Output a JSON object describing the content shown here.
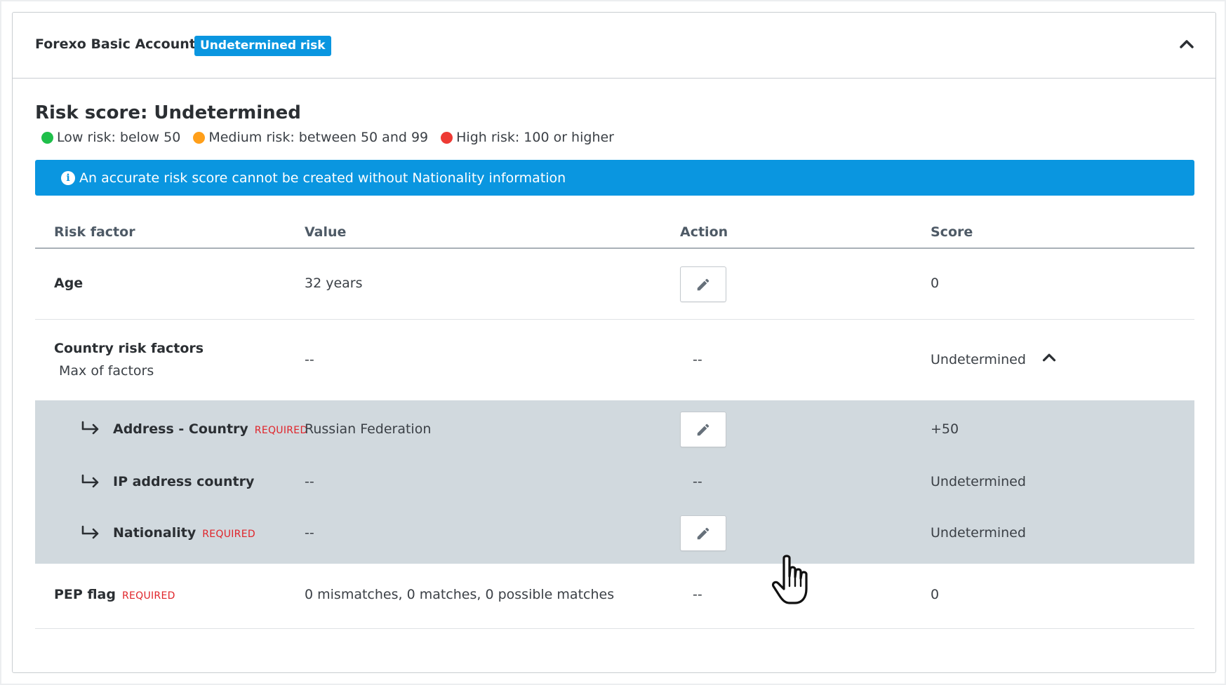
{
  "header": {
    "account_name": "Forexo Basic Account",
    "risk_badge": "Undetermined risk",
    "collapse_icon": "chevron-up-icon"
  },
  "risk_score": {
    "title": "Risk score: Undetermined",
    "legend": [
      {
        "label": "Low risk: below 50",
        "color": "#1fbf4a"
      },
      {
        "label": "Medium risk: between 50 and 99",
        "color": "#ff9f1a"
      },
      {
        "label": "High risk: 100 or higher",
        "color": "#ee3a34"
      }
    ]
  },
  "banner": {
    "icon": "info-icon",
    "text": "An accurate risk score cannot be created without Nationality information"
  },
  "table": {
    "headers": {
      "factor": "Risk factor",
      "value": "Value",
      "action": "Action",
      "score": "Score"
    },
    "required_label": "REQUIRED",
    "rows": {
      "age": {
        "factor": "Age",
        "value": "32 years",
        "score": "0"
      },
      "country": {
        "factor": "Country risk factors",
        "subtitle": "Max of factors",
        "value": "--",
        "action": "--",
        "score": "Undetermined"
      },
      "address_country": {
        "factor": "Address - Country",
        "value": "Russian Federation",
        "score": "+50"
      },
      "ip_country": {
        "factor": "IP address country",
        "value": "--",
        "action": "--",
        "score": "Undetermined"
      },
      "nationality": {
        "factor": "Nationality",
        "value": "--",
        "score": "Undetermined"
      },
      "pep": {
        "factor": "PEP flag",
        "value": "0 mismatches, 0 matches, 0 possible matches",
        "action": "--",
        "score": "0"
      }
    }
  },
  "colors": {
    "accent": "#0a96e0",
    "subgroup_bg": "#d1d9de",
    "required": "#e0242a"
  }
}
